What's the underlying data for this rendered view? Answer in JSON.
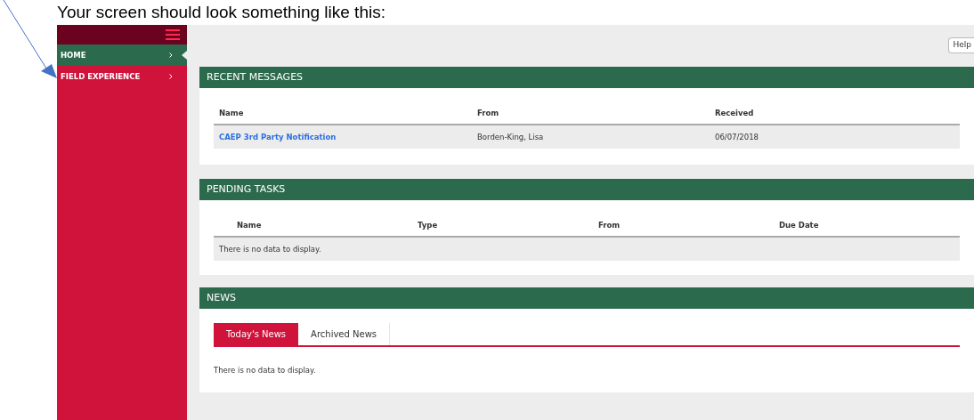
{
  "caption": "Your screen should look something like this:",
  "sidebar": {
    "items": [
      {
        "label": "HOME",
        "selected": true
      },
      {
        "label": "FIELD EXPERIENCE",
        "selected": false
      }
    ]
  },
  "toolbar": {
    "help_button": "Help"
  },
  "recent_messages": {
    "title": "RECENT MESSAGES",
    "columns": [
      "Name",
      "From",
      "Received"
    ],
    "rows": [
      {
        "name": "CAEP 3rd Party Notification",
        "from": "Borden-King, Lisa",
        "received": "06/07/2018"
      }
    ]
  },
  "pending_tasks": {
    "title": "PENDING TASKS",
    "columns": [
      "Name",
      "Type",
      "From",
      "Due Date"
    ],
    "empty_text": "There is no data to display."
  },
  "news": {
    "title": "NEWS",
    "tabs": [
      {
        "label": "Today's News",
        "selected": true
      },
      {
        "label": "Archived News",
        "selected": false
      }
    ],
    "empty_text": "There is no data to display."
  }
}
